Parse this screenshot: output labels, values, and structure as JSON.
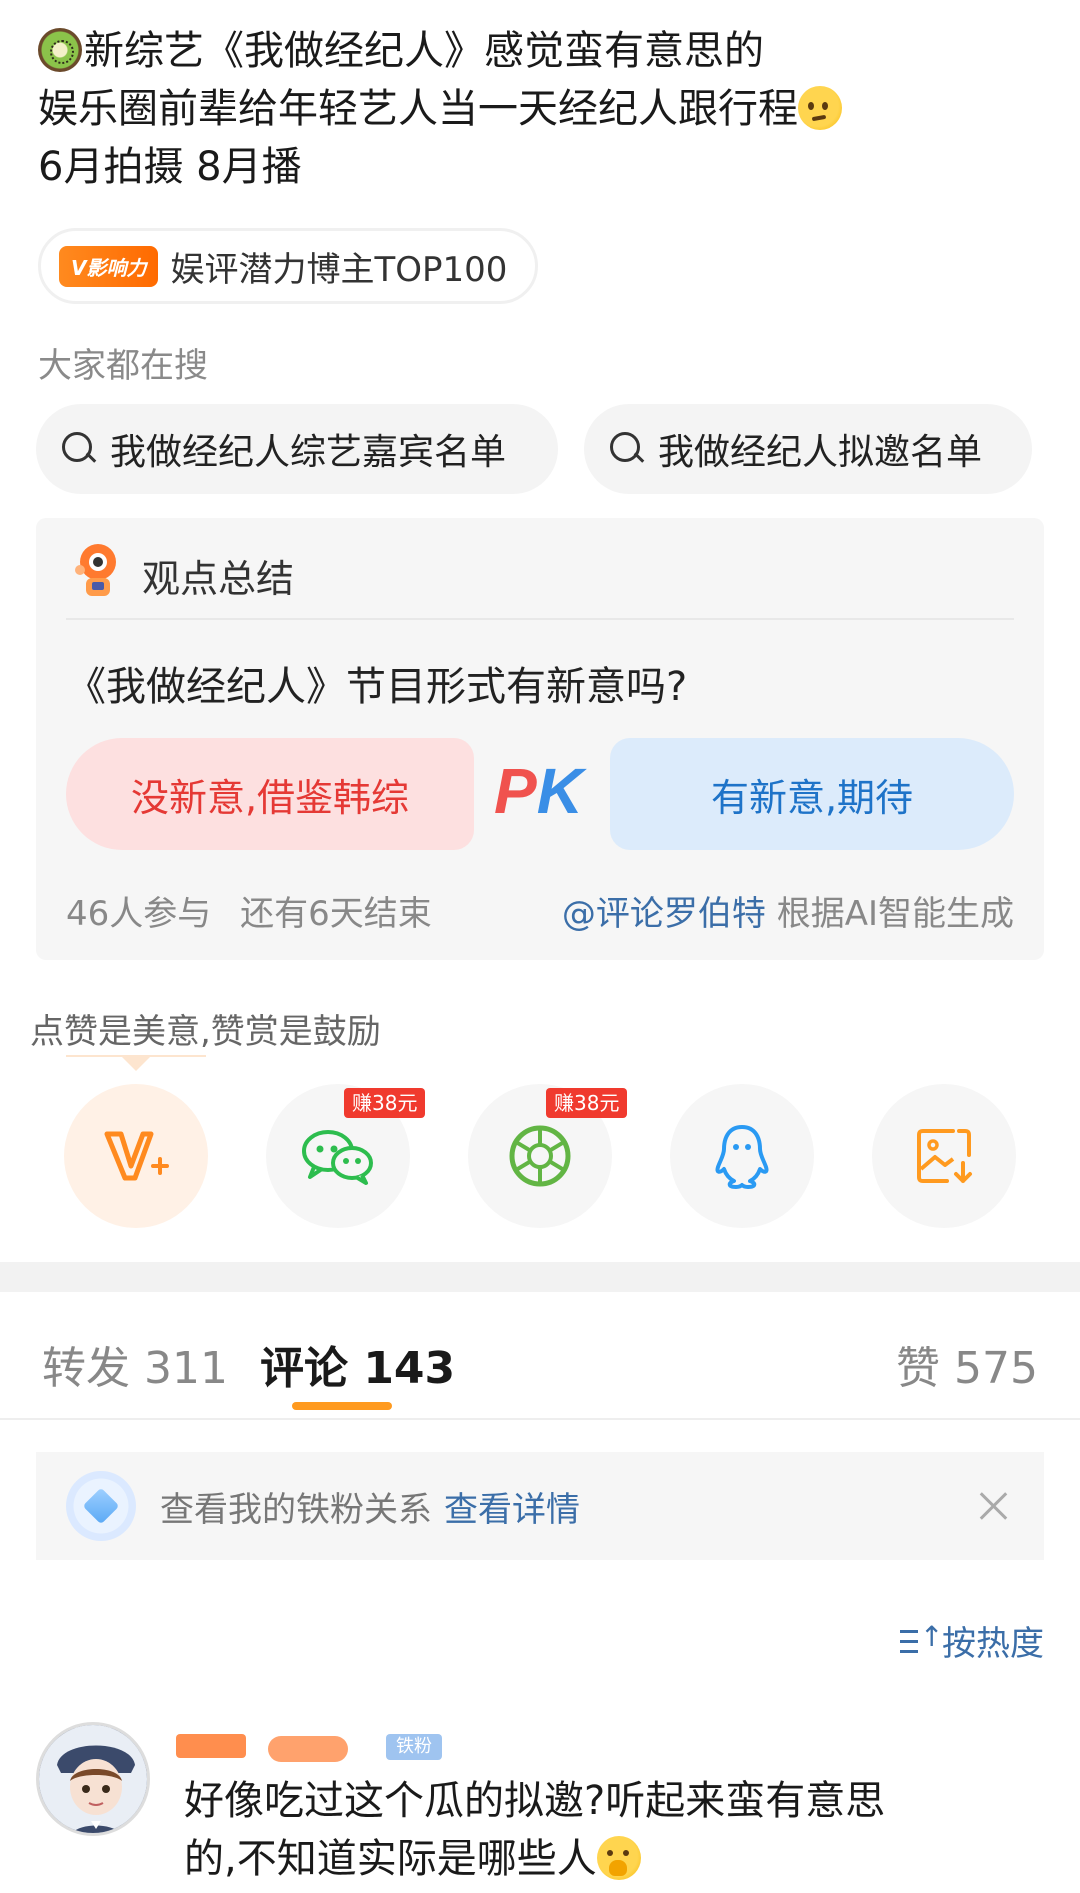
{
  "post": {
    "line1": "新综艺《我做经纪人》感觉蛮有意思的",
    "line2": "娱乐圈前辈给年轻艺人当一天经纪人跟行程",
    "line3": "6月拍摄 8月播"
  },
  "influence_badge": {
    "tag": "V影响力",
    "text": "娱评潜力博主TOP100"
  },
  "searching": {
    "label": "大家都在搜",
    "chips": [
      "我做经纪人综艺嘉宾名单",
      "我做经纪人拟邀名单"
    ]
  },
  "summary": {
    "title": "观点总结",
    "question": "《我做经纪人》节目形式有新意吗?",
    "option_left": "没新意,借鉴韩综",
    "option_right": "有新意,期待",
    "participants": "46人参与",
    "remaining": "还有6天结束",
    "credit_mention": "@评论罗伯特",
    "credit_text": "根据AI智能生成"
  },
  "reward": {
    "label": "点赞是美意,赞赏是鼓励",
    "share_items": [
      {
        "icon": "vplus-icon"
      },
      {
        "icon": "wechat-icon",
        "earn": "赚38元"
      },
      {
        "icon": "moments-icon",
        "earn": "赚38元"
      },
      {
        "icon": "qq-icon"
      },
      {
        "icon": "save-image-icon"
      }
    ]
  },
  "tabs": {
    "repost": "转发 311",
    "comment": "评论 143",
    "like": "赞 575"
  },
  "fan_banner": {
    "text": "查看我的铁粉关系",
    "link": "查看详情"
  },
  "sort": {
    "label": "按热度"
  },
  "comment": {
    "fan_badge": "铁粉",
    "line1": "好像吃过这个瓜的拟邀?听起来蛮有意思",
    "line2": "的,不知道实际是哪些人"
  },
  "colors": {
    "accent_orange": "#ff9a1f",
    "link_blue": "#3b6ea8",
    "pk_red": "#e53935",
    "pk_blue": "#1e73c8"
  }
}
